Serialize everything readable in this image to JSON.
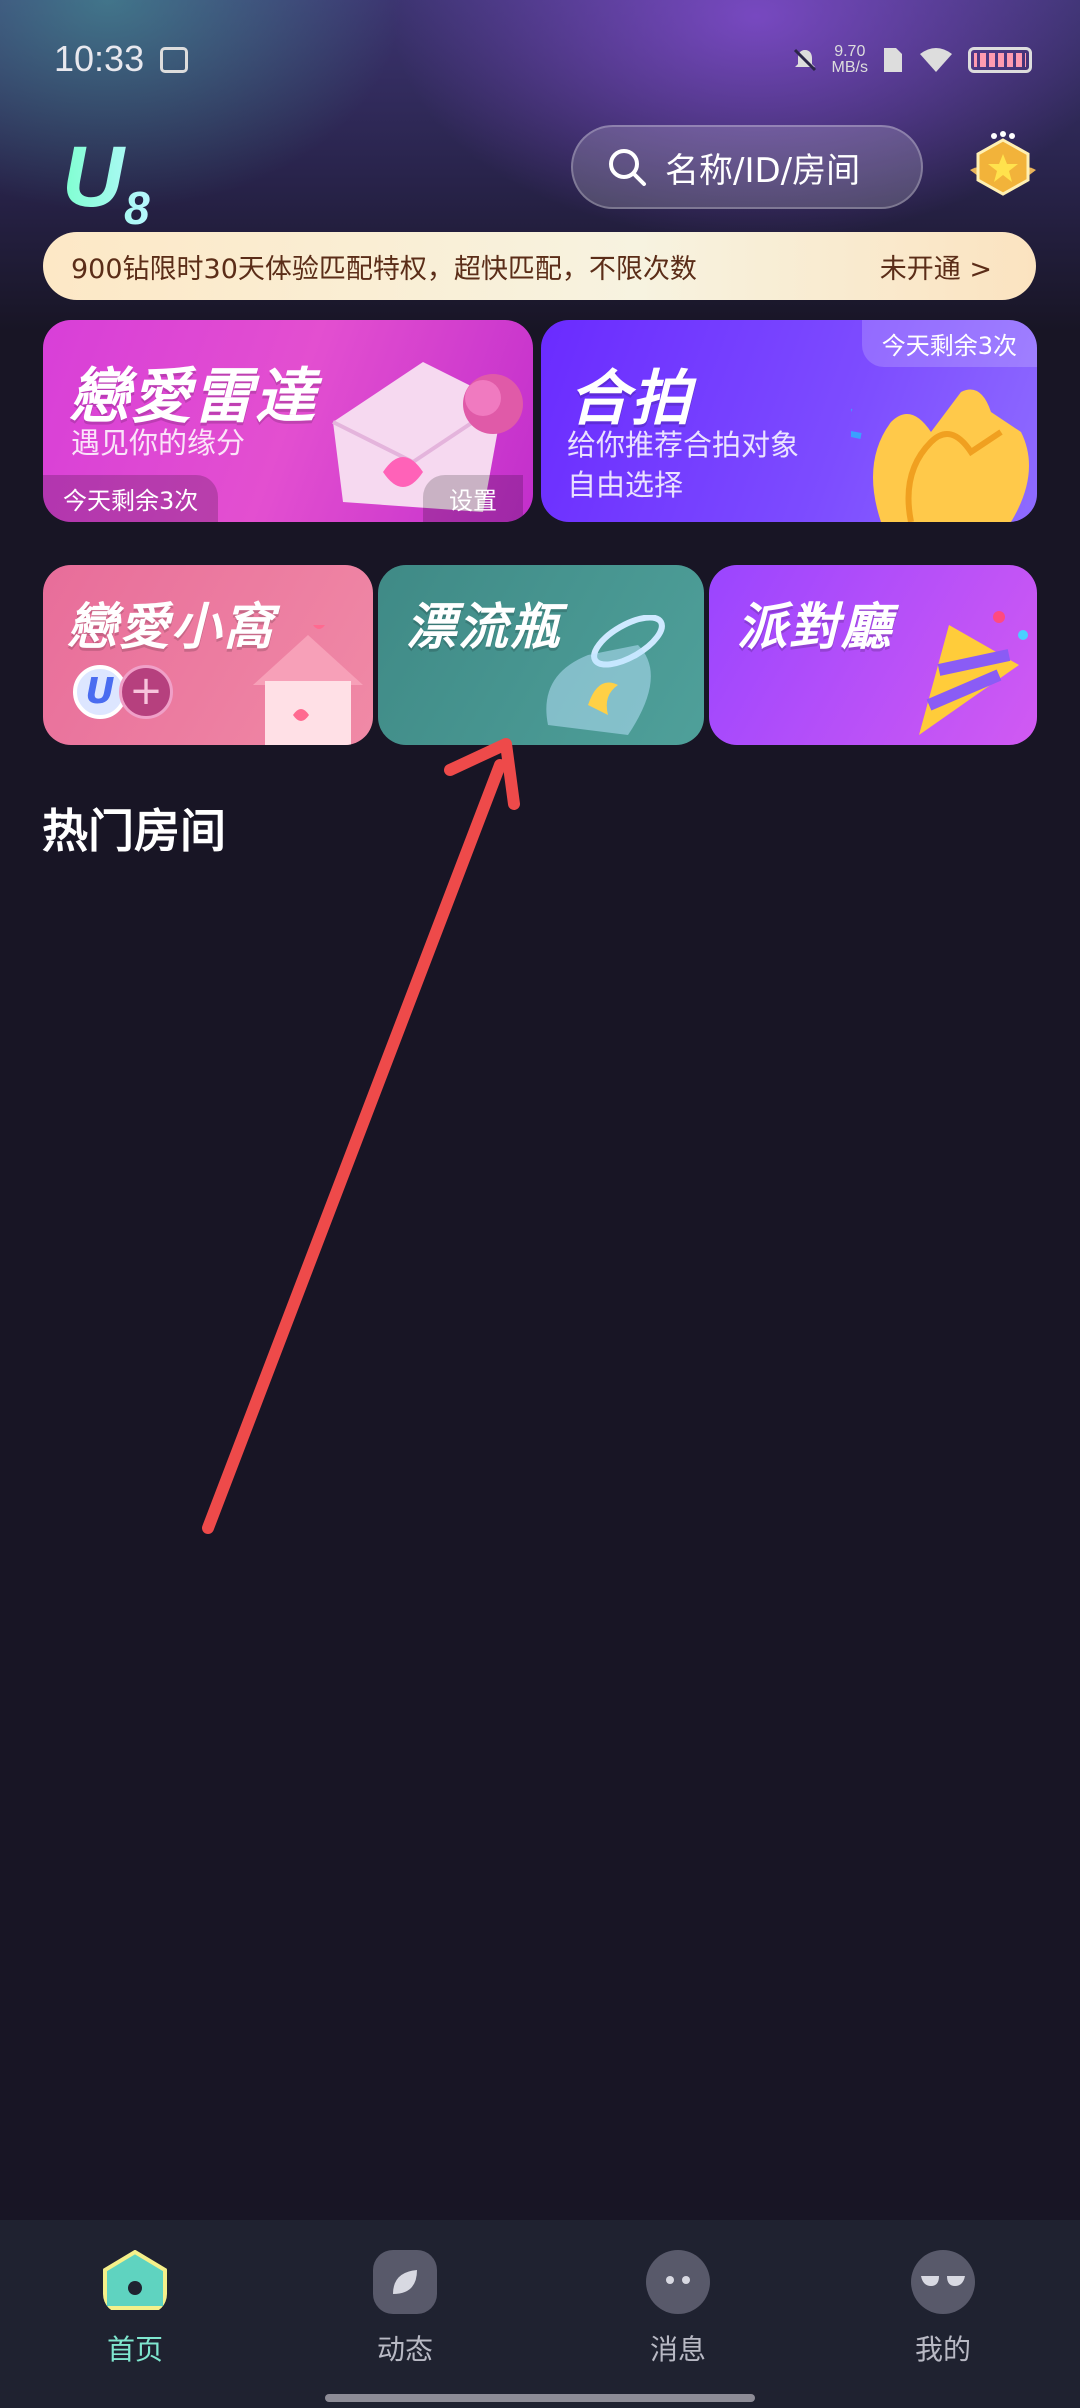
{
  "status": {
    "time": "10:33",
    "speed_value": "9.70",
    "speed_unit": "MB/s"
  },
  "header": {
    "logo": "U",
    "logo_sub": "8",
    "search_placeholder": "名称/ID/房间"
  },
  "promo": {
    "text": "900钻限时30天体验匹配特权，超快匹配，不限次数",
    "link": "未开通 >"
  },
  "cards": {
    "love_radar": {
      "title": "戀愛雷達",
      "subtitle": "遇见你的缘分",
      "remaining": "今天剩余3次",
      "setting": "设置"
    },
    "heshot": {
      "title": "合拍",
      "subtitle1": "给你推荐合拍对象",
      "subtitle2": "自由选择",
      "remaining": "今天剩余3次"
    },
    "nest": {
      "title": "戀愛小窩",
      "avatar_letter": "U",
      "add_symbol": "+"
    },
    "bottle": {
      "title": "漂流瓶"
    },
    "party": {
      "title": "派對廳"
    }
  },
  "section": {
    "hot_rooms": "热门房间"
  },
  "nav": [
    {
      "label": "首页",
      "icon": "home-icon",
      "active": true
    },
    {
      "label": "动态",
      "icon": "leaf-icon",
      "active": false
    },
    {
      "label": "消息",
      "icon": "chat-icon",
      "active": false
    },
    {
      "label": "我的",
      "icon": "profile-icon",
      "active": false
    }
  ],
  "colors": {
    "accent": "#7fe7cf",
    "annotation": "#ee4a4a",
    "background": "#181525"
  }
}
